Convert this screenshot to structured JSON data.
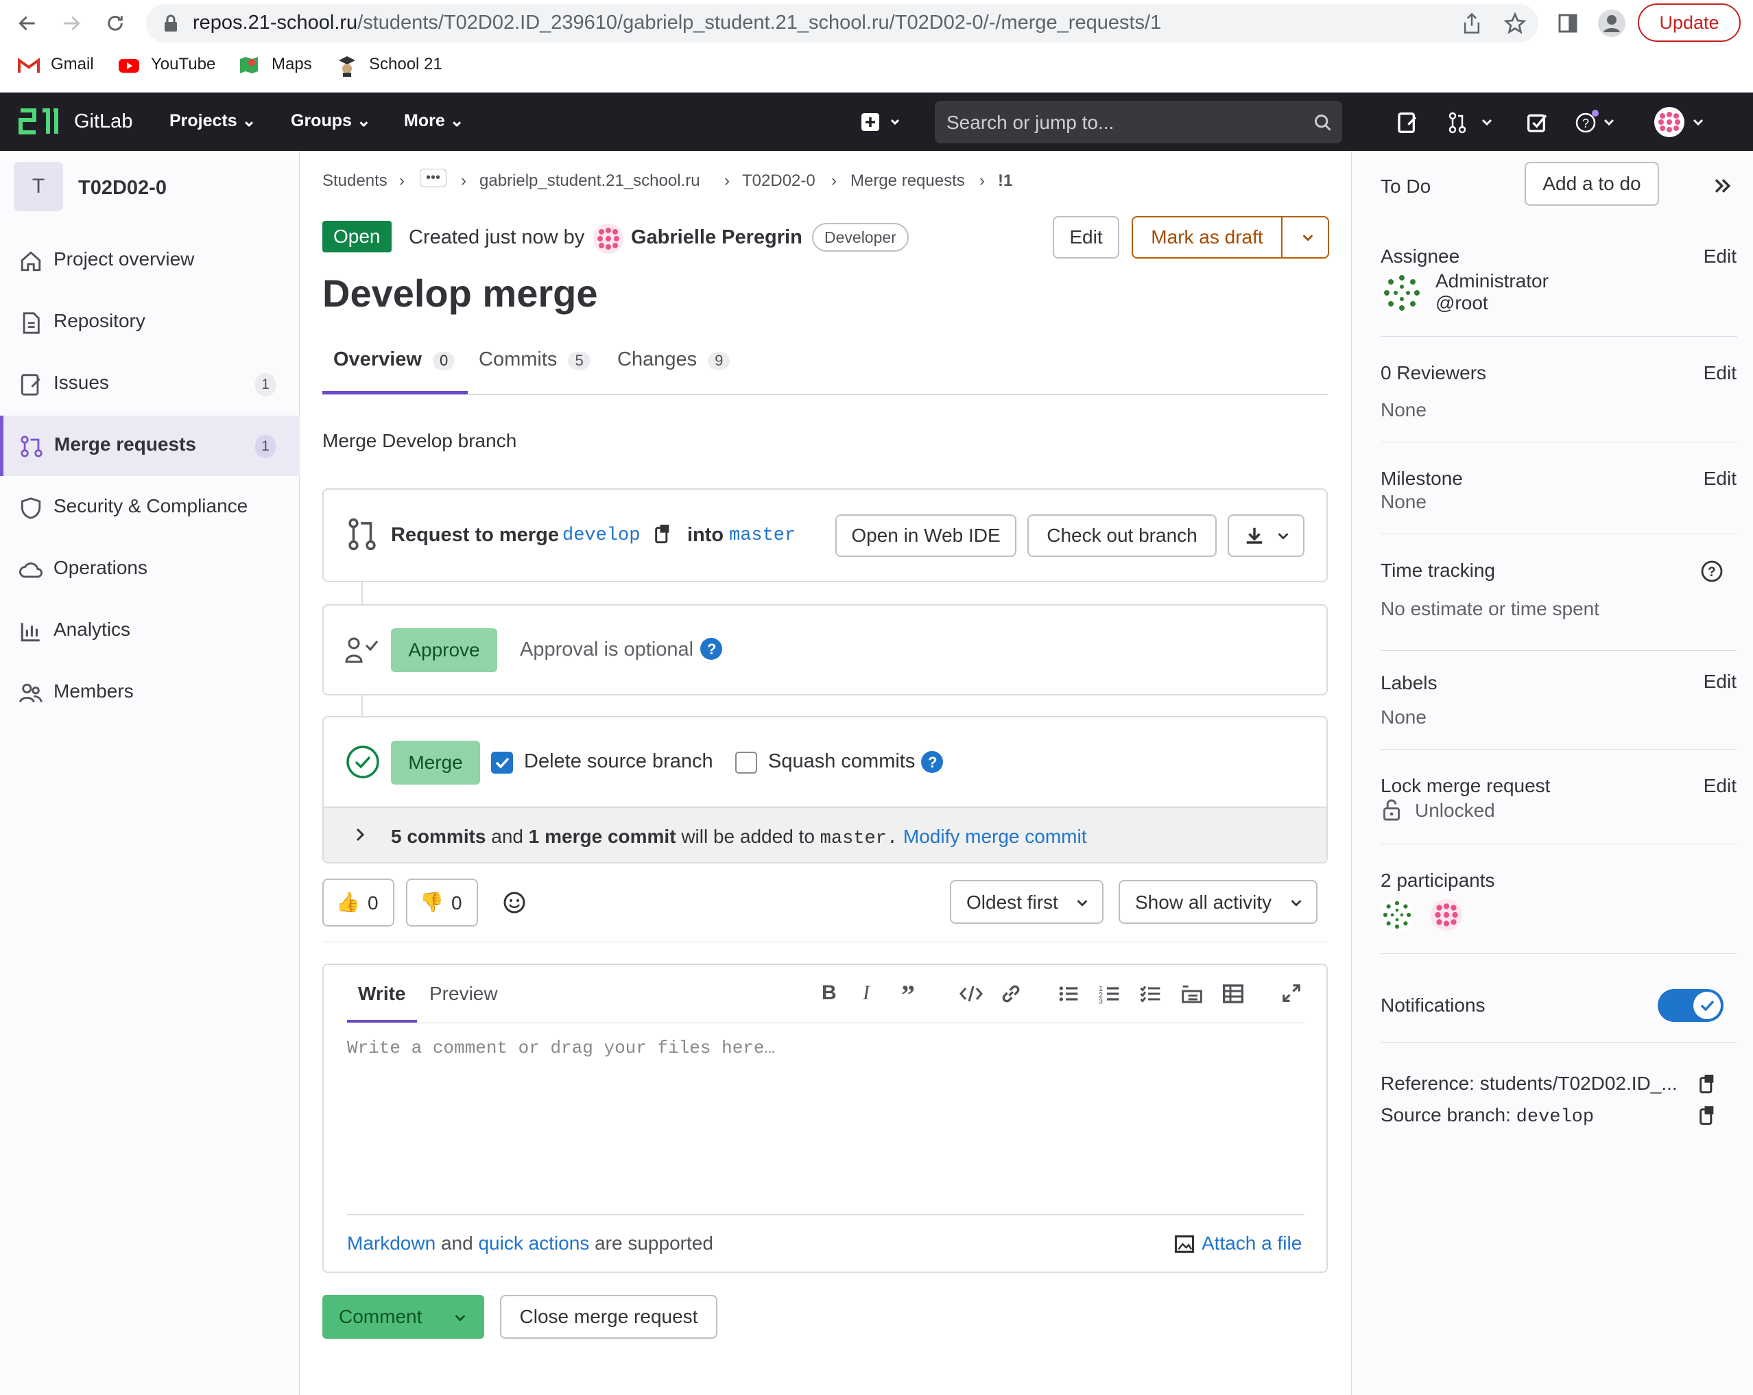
{
  "browser": {
    "url_host": "repos.21-school.ru",
    "url_path": "/students/T02D02.ID_239610/gabrielp_student.21_school.ru/T02D02-0/-/merge_requests/1",
    "update_label": "Update",
    "bookmarks": [
      {
        "label": "Gmail",
        "icon": "gmail-icon"
      },
      {
        "label": "YouTube",
        "icon": "youtube-icon"
      },
      {
        "label": "Maps",
        "icon": "maps-icon"
      },
      {
        "label": "School 21",
        "icon": "school21-icon"
      }
    ]
  },
  "topnav": {
    "logo_text": "GitLab",
    "items": [
      "Projects",
      "Groups",
      "More"
    ],
    "search_placeholder": "Search or jump to..."
  },
  "sidebar": {
    "project_initial": "T",
    "project_name": "T02D02-0",
    "items": [
      {
        "label": "Project overview",
        "icon": "home-icon"
      },
      {
        "label": "Repository",
        "icon": "doc-icon"
      },
      {
        "label": "Issues",
        "icon": "issues-icon",
        "count": "1"
      },
      {
        "label": "Merge requests",
        "icon": "merge-request-icon",
        "count": "1",
        "active": true
      },
      {
        "label": "Security & Compliance",
        "icon": "shield-icon"
      },
      {
        "label": "Operations",
        "icon": "cloud-icon"
      },
      {
        "label": "Analytics",
        "icon": "chart-icon"
      },
      {
        "label": "Members",
        "icon": "users-icon"
      }
    ]
  },
  "breadcrumb": [
    "Students",
    "•••",
    "gabrielp_student.21_school.ru",
    "T02D02-0",
    "Merge requests",
    "!1"
  ],
  "header": {
    "status": "Open",
    "created_text": "Created just now by",
    "author": "Gabrielle Peregrin",
    "role": "Developer",
    "edit_label": "Edit",
    "draft_label": "Mark as draft",
    "title": "Develop merge"
  },
  "tabs": [
    {
      "label": "Overview",
      "count": "0"
    },
    {
      "label": "Commits",
      "count": "5"
    },
    {
      "label": "Changes",
      "count": "9"
    }
  ],
  "description": "Merge Develop branch",
  "merge_widget": {
    "request_label": "Request to merge",
    "source_branch": "develop",
    "into_label": "into",
    "target_branch": "master",
    "open_ide_label": "Open in Web IDE",
    "checkout_label": "Check out branch",
    "approve_label": "Approve",
    "approval_text": "Approval is optional",
    "merge_label": "Merge",
    "delete_source_label": "Delete source branch",
    "squash_label": "Squash commits",
    "commits_count_text": "5 commits",
    "and_text": "and",
    "merge_commit_text": "1 merge commit",
    "added_text": "will be added to",
    "target_mono": "master.",
    "modify_link": "Modify merge commit"
  },
  "reactions": {
    "thumbs_up": "0",
    "thumbs_down": "0"
  },
  "sort": {
    "order_label": "Oldest first",
    "filter_label": "Show all activity"
  },
  "comment": {
    "write_tab": "Write",
    "preview_tab": "Preview",
    "placeholder": "Write a comment or drag your files here…",
    "markdown_link": "Markdown",
    "and_text": "and",
    "quick_actions_link": "quick actions",
    "supported_text": "are supported",
    "attach_label": "Attach a file",
    "comment_button": "Comment",
    "close_button": "Close merge request"
  },
  "right_sidebar": {
    "todo_label": "To Do",
    "add_todo_label": "Add a to do",
    "edit_label": "Edit",
    "assignee_title": "Assignee",
    "assignee_name": "Administrator",
    "assignee_handle": "@root",
    "reviewers_title": "0 Reviewers",
    "reviewers_value": "None",
    "milestone_title": "Milestone",
    "milestone_value": "None",
    "time_title": "Time tracking",
    "time_value": "No estimate or time spent",
    "labels_title": "Labels",
    "labels_value": "None",
    "lock_title": "Lock merge request",
    "lock_value": "Unlocked",
    "participants_title": "2 participants",
    "notifications_title": "Notifications",
    "reference_text": "Reference: students/T02D02.ID_...",
    "source_branch_label": "Source branch:",
    "source_branch_value": "develop"
  },
  "colors": {
    "nav_bg": "#1f1e24",
    "accent": "#6e49cb",
    "green": "#108548",
    "link": "#1f75cb"
  }
}
